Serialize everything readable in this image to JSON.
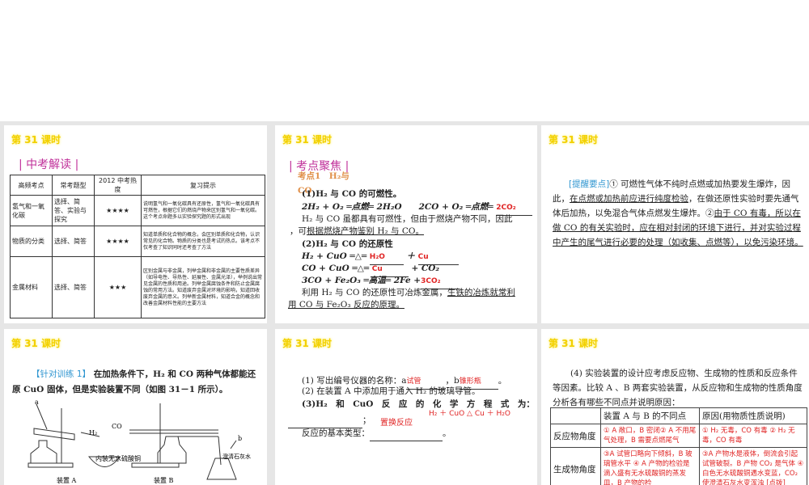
{
  "slide_title": "第 31 课时",
  "s1": {
    "heading": "| 中考解读 |",
    "headers": [
      "高频考点",
      "常考题型",
      "2012 中考热度",
      "复习提示"
    ],
    "rows": [
      {
        "point": "氢气和一氧化碳",
        "type": "选择、简答、实验与探究",
        "heat": "★★★★",
        "tip": "说明氢气和一氧化碳具有还原性，氢气和一氧化碳具有可燃性，根据它们的燃烧产物来区别氢气和一氧化碳。这个考点命题多以实验探究题的形式出现"
      },
      {
        "point": "物质的分类",
        "type": "选择、简答",
        "heat": "★★★★",
        "tip": "知道单质和化合物的概念，会区别单质和化合物，认识常见的化合物。物质的分类也是考试的热点。该考点不仅考查了知识同时还考查了方法"
      },
      {
        "point": "金属材料",
        "type": "选择、简答",
        "heat": "★★★",
        "tip": "区别金属与非金属，列举金属和非金属的主要性质差异（如导电性、导热性、延展性、金属光泽），举例说出常见金属的性质和用途。列举金属腐蚀条件和防止金属腐蚀的常用方法。知道废弃金属对环境的影响，知道回收废弃金属的意义。列举新金属材料，知道合金的概念和改善金属材料性能的主要方法"
      }
    ]
  },
  "s2": {
    "heading": "| 考点聚焦 |",
    "kp": "考点1　H₂与 CO",
    "l1": "(1)H₂ 与 CO 的可燃性。",
    "eq1": "2H₂ + O₂ ═点燃═ 2H₂O　　2CO + O₂ ═点燃═",
    "a1": "2CO₂",
    "l2": "H₂ 与 CO 虽都具有可燃性，但由于燃烧产物不同，因此",
    "l3a": "，可",
    "l3b": "根据燃烧产物鉴别 H₂ 与 CO。",
    "l4": "(2)H₂ 与 CO 的还原性",
    "eq2a": "H₂ + CuO ═△═",
    "a2": "H₂O",
    "a3": "Cu",
    "eq3a": "CO + CuO ═△═",
    "a4": "Cu",
    "eq3b": "+ CO₂",
    "eq4": "3CO + Fe₂O₃ ═高温═ 2Fe +",
    "a5": "3CO₂",
    "l5a": "利用 H₂ 与 CO 的还原性可冶炼金属，",
    "l5b": "生铁的冶炼就常利",
    "l6": "用 CO 与 Fe₂O₃ 反应的原理。"
  },
  "s3": {
    "tag": "[提醒要点]",
    "p1": "① 可燃性气体不纯时点燃或加热要发生爆炸，因此，",
    "u1": "在点燃或加热前应进行纯度检验",
    "p2": "，在做还原性实验时要先通气体后加热，以免混合气体点燃发生爆炸。②",
    "u2": "由于 CO 有毒，所以在做 CO 的有关实验时，应在相对封闭的环境下进行，并对实验过程中产生的尾气进行必要的处理（如收集、点燃等），以免污染环境。"
  },
  "s4": {
    "tag": "【针对训练 1】",
    "text": "在加热条件下，H₂ 和 CO 两种气体都能还原 CuO 固体，但是实验装置不同（如图 31－1 所示）。",
    "fig": {
      "a": "a",
      "b": "b",
      "h2": "H₂",
      "co": "CO",
      "dish": "内装无水硫酸铜",
      "lime": "澄清石灰水",
      "labelA": "装置 A",
      "labelB": "装置 B"
    }
  },
  "s5": {
    "q1": "(1) 写出编号仪器的名称：a",
    "q1b": "，b",
    "q1end": "。",
    "ans_a": "试管",
    "ans_b": "锥形瓶",
    "q2": "(2) 在装置 A 中添加用于通入 H₂ 的玻璃导管。",
    "q3": "(3)H₂　和　CuO　反　应　的　化　学　方　程　式　为：",
    "ans_eq": "H₂ ＋ CuO △ Cu ＋ H₂O",
    "q3end": "；",
    "q4": "反应的基本类型：",
    "ans_type": "置换反应",
    "q4end": "。"
  },
  "s6": {
    "intro": "(4) 实验装置的设计应考虑反应物、生成物的性质和反应条件等因素。比较 A 、B 两套实验装置，从反应物和生成物的性质角度分析各有哪些不同点并说明原因：",
    "headers": [
      "",
      "装置 A 与 B 的不同点",
      "原因(用物质性质说明)"
    ],
    "rows": [
      {
        "label": "反应物角度",
        "diff": "① A 敞口，B 密闭② A 不用尾气处理，B 需要点燃尾气",
        "reason": "① H₂ 无毒，CO 有毒 ② H₂ 无毒，CO 有毒"
      },
      {
        "label": "生成物角度",
        "diff": "③A 试管口略向下倾斜，B 玻璃管水平 ④ A 产物的检验是滴入盛有无水硫酸铜的蒸发皿，B 产物的检",
        "reason": "③A 产物水是液体，倒流会引起试管破裂。B 产物 CO₂ 是气体 ④ 白色无水硫酸铜遇水变蓝，CO₂ 使澄清石灰水变浑浊 [点拨]"
      }
    ]
  }
}
